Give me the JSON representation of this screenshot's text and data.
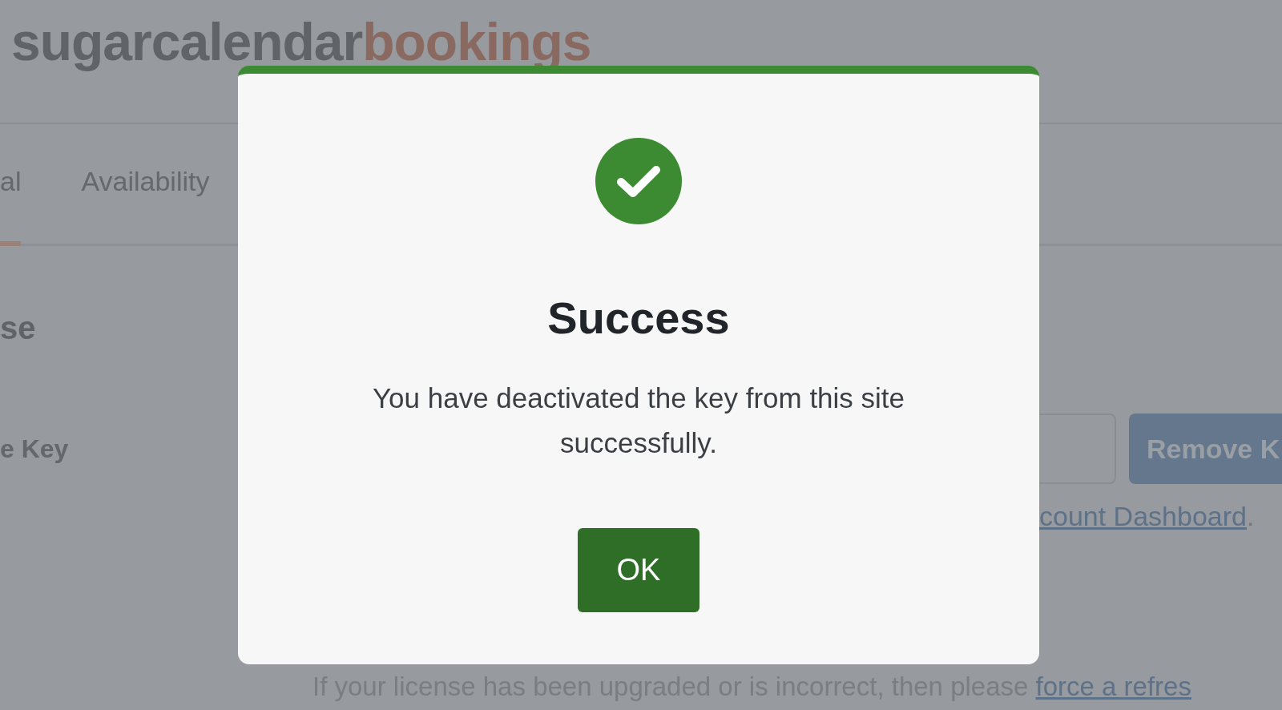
{
  "logo": {
    "primary": "sugarcalendar",
    "accent": "bookings"
  },
  "tabs": [
    {
      "label": "al",
      "selected": true
    },
    {
      "label": "Availability",
      "selected": false
    }
  ],
  "section": {
    "heading": "se",
    "field_label": "e Key",
    "button": "Remove K",
    "link_line": {
      "link": "count Dashboard",
      "after": "."
    },
    "note": {
      "text": "If your license has been upgraded or is incorrect, then please ",
      "link": "force a refres"
    }
  },
  "dialog": {
    "title": "Success",
    "message": "You have deactivated the key from this site successfully.",
    "button": "OK"
  }
}
